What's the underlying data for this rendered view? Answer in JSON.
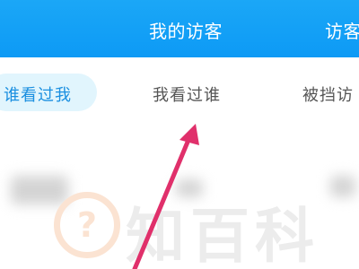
{
  "header": {
    "tabs": [
      {
        "label": "我的访客"
      },
      {
        "label": "访客"
      }
    ]
  },
  "segments": {
    "tabs": [
      {
        "label": "谁看过我",
        "selected": true
      },
      {
        "label": "我看过谁",
        "selected": false
      },
      {
        "label": "被挡访",
        "selected": false
      }
    ]
  },
  "watermark": {
    "text": "知百科"
  },
  "colors": {
    "header_blue": "#0d9af5",
    "selected_text": "#1a8fe0",
    "selected_pill": "#e1f5fd",
    "arrow": "#e0306b"
  }
}
